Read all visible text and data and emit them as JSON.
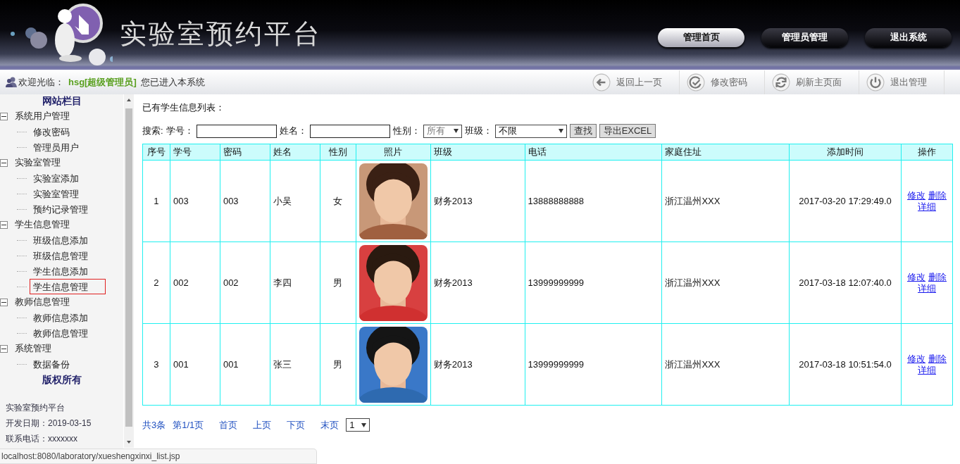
{
  "header": {
    "title": "实验室预约平台",
    "nav": [
      {
        "label": "管理首页",
        "selected": true
      },
      {
        "label": "管理员管理",
        "selected": false
      },
      {
        "label": "退出系统",
        "selected": false
      }
    ]
  },
  "welcome": {
    "prefix": "欢迎光临：",
    "user": "hsg[超级管理员]",
    "suffix": "您已进入本系统"
  },
  "toolbar": [
    {
      "label": "返回上一页",
      "kind": "back"
    },
    {
      "label": "修改密码",
      "kind": "check"
    },
    {
      "label": "刷新主页面",
      "kind": "refresh"
    },
    {
      "label": "退出管理",
      "kind": "power"
    }
  ],
  "sidebar": {
    "title": "网站栏目",
    "tree": [
      {
        "label": "系统用户管理",
        "expanded": true,
        "selected": false,
        "children": [
          {
            "label": "修改密码",
            "selected": false
          },
          {
            "label": "管理员用户",
            "selected": false
          }
        ]
      },
      {
        "label": "实验室管理",
        "expanded": true,
        "selected": false,
        "children": [
          {
            "label": "实验室添加",
            "selected": false
          },
          {
            "label": "实验室管理",
            "selected": false
          },
          {
            "label": "预约记录管理",
            "selected": false
          }
        ]
      },
      {
        "label": "学生信息管理",
        "expanded": true,
        "selected": false,
        "children": [
          {
            "label": "班级信息添加",
            "selected": false
          },
          {
            "label": "班级信息管理",
            "selected": false
          },
          {
            "label": "学生信息添加",
            "selected": false
          },
          {
            "label": "学生信息管理",
            "selected": true
          }
        ]
      },
      {
        "label": "教师信息管理",
        "expanded": true,
        "selected": false,
        "children": [
          {
            "label": "教师信息添加",
            "selected": false
          },
          {
            "label": "教师信息管理",
            "selected": false
          }
        ]
      },
      {
        "label": "系统管理",
        "expanded": true,
        "selected": false,
        "children": [
          {
            "label": "数据备份",
            "selected": false
          }
        ]
      }
    ],
    "footer_title": "版权所有",
    "footer_lines": [
      "实验室预约平台",
      "开发日期：2019-03-15",
      "联系电话：xxxxxxx"
    ]
  },
  "main": {
    "heading": "已有学生信息列表：",
    "search": {
      "label": "搜索:",
      "fields": [
        {
          "label": "学号：",
          "kind": "text"
        },
        {
          "label": "姓名：",
          "kind": "text"
        },
        {
          "label": "性别：",
          "kind": "select",
          "value": "所有"
        },
        {
          "label": "班级：",
          "kind": "select",
          "value": "不限"
        }
      ],
      "buttons": [
        "查找",
        "导出EXCEL"
      ]
    },
    "table": {
      "columns": [
        "序号",
        "学号",
        "密码",
        "姓名",
        "性别",
        "照片",
        "班级",
        "电话",
        "家庭住址",
        "添加时间",
        "操作"
      ],
      "rows": [
        {
          "index": "1",
          "id": "003",
          "password": "003",
          "name": "小吴",
          "gender": "女",
          "photo": {
            "kind": "picture"
          },
          "class": "财务2013",
          "phone": "13888888888",
          "address": "浙江温州XXX",
          "time": "2017-03-20 17:29:49.0",
          "actions": [
            "修改",
            "删除",
            "详细"
          ]
        },
        {
          "index": "2",
          "id": "002",
          "password": "002",
          "name": "李四",
          "gender": "男",
          "photo": {
            "kind": "picture"
          },
          "class": "财务2013",
          "phone": "13999999999",
          "address": "浙江温州XXX",
          "time": "2017-03-18 12:07:40.0",
          "actions": [
            "修改",
            "删除",
            "详细"
          ]
        },
        {
          "index": "3",
          "id": "001",
          "password": "001",
          "name": "张三",
          "gender": "男",
          "photo": {
            "kind": "picture"
          },
          "class": "财务2013",
          "phone": "13999999999",
          "address": "浙江温州XXX",
          "time": "2017-03-18 10:51:54.0",
          "actions": [
            "修改",
            "删除",
            "详细"
          ]
        }
      ]
    },
    "pagination": {
      "total": "共3条",
      "page": "第1/1页",
      "links": [
        "首页",
        "上页",
        "下页",
        "末页"
      ],
      "select": "1"
    }
  },
  "status_bar": "localhost:8080/laboratory/xueshengxinxi_list.jsp"
}
